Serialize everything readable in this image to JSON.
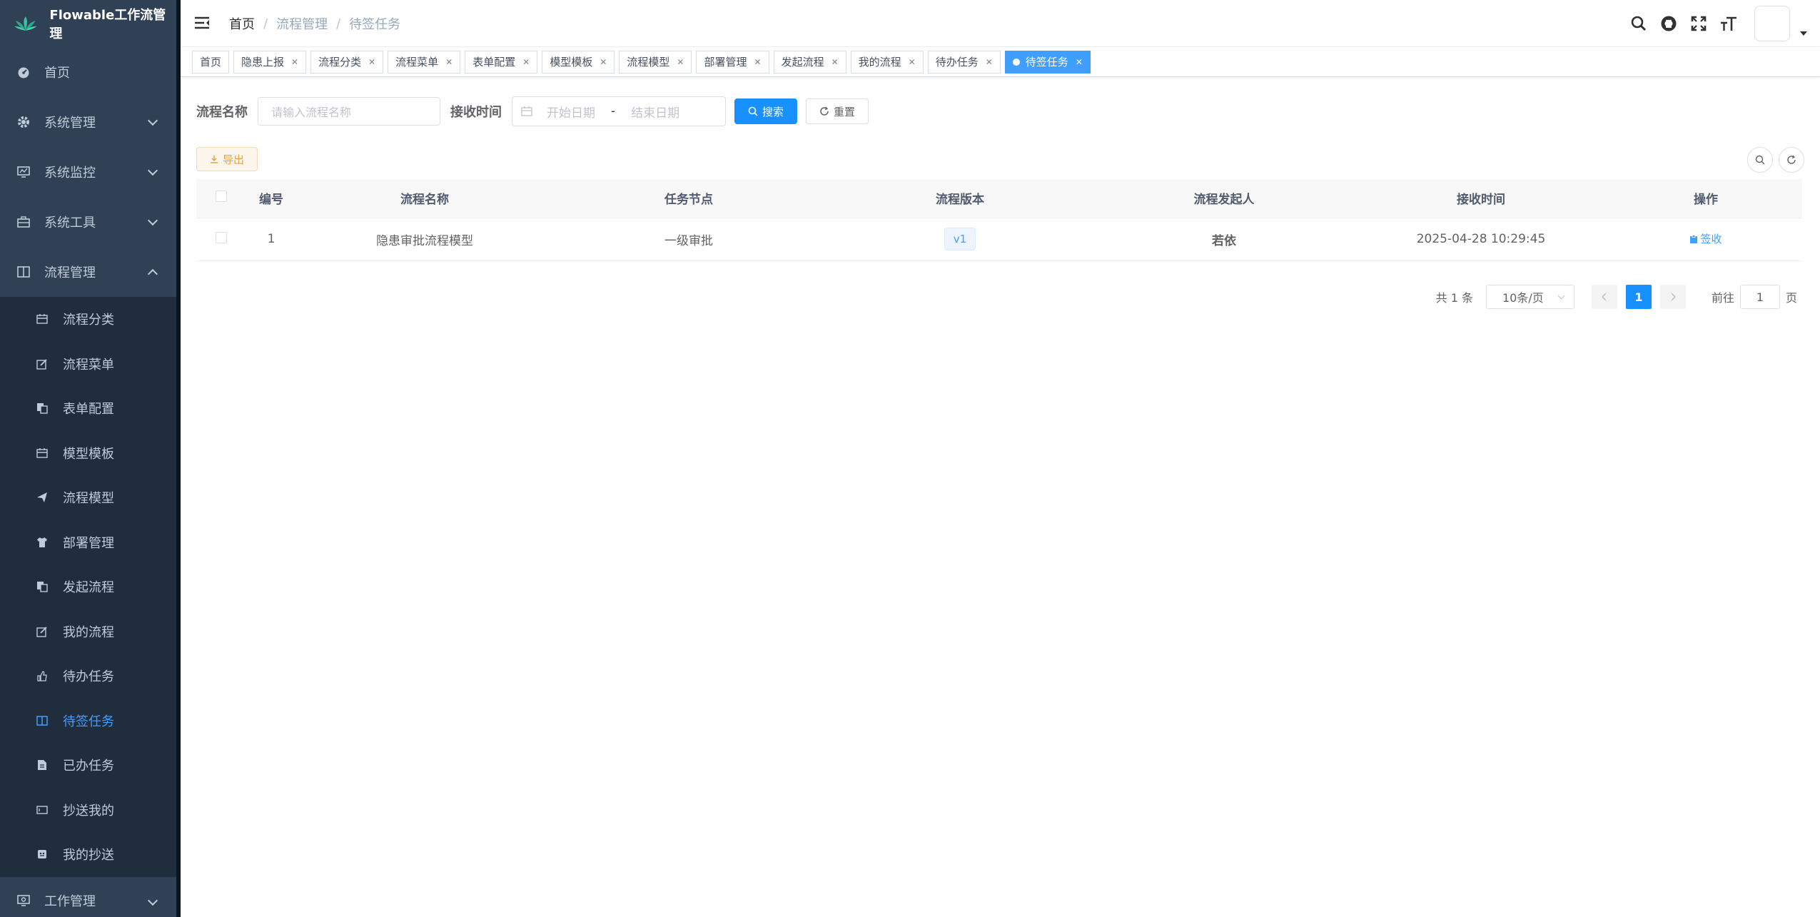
{
  "app": {
    "title": "Flowable工作流管理"
  },
  "sidebar": {
    "items": [
      {
        "label": "首页",
        "icon": "dashboard-icon"
      },
      {
        "label": "系统管理",
        "icon": "system-gear-icon"
      },
      {
        "label": "系统监控",
        "icon": "monitor-icon"
      },
      {
        "label": "系统工具",
        "icon": "toolbox-icon"
      },
      {
        "label": "流程管理",
        "icon": "process-book-icon"
      }
    ],
    "submenu": [
      {
        "label": "流程分类",
        "icon": "calendar-icon"
      },
      {
        "label": "流程菜单",
        "icon": "edit-icon"
      },
      {
        "label": "表单配置",
        "icon": "copy-icon"
      },
      {
        "label": "模型模板",
        "icon": "calendar-icon"
      },
      {
        "label": "流程模型",
        "icon": "send-icon"
      },
      {
        "label": "部署管理",
        "icon": "shirt-icon"
      },
      {
        "label": "发起流程",
        "icon": "copy-icon"
      },
      {
        "label": "我的流程",
        "icon": "edit-icon"
      },
      {
        "label": "待办任务",
        "icon": "hand-icon"
      },
      {
        "label": "待签任务",
        "icon": "book-icon"
      },
      {
        "label": "已办任务",
        "icon": "document-icon"
      },
      {
        "label": "抄送我的",
        "icon": "ticket-icon"
      },
      {
        "label": "我的抄送",
        "icon": "message-icon"
      }
    ],
    "work": {
      "label": "工作管理",
      "icon": "monitor-icon"
    }
  },
  "breadcrumb": [
    "首页",
    "流程管理",
    "待签任务"
  ],
  "tags": [
    {
      "label": "首页",
      "closable": false
    },
    {
      "label": "隐患上报",
      "closable": true
    },
    {
      "label": "流程分类",
      "closable": true
    },
    {
      "label": "流程菜单",
      "closable": true
    },
    {
      "label": "表单配置",
      "closable": true
    },
    {
      "label": "模型模板",
      "closable": true
    },
    {
      "label": "流程模型",
      "closable": true
    },
    {
      "label": "部署管理",
      "closable": true
    },
    {
      "label": "发起流程",
      "closable": true
    },
    {
      "label": "我的流程",
      "closable": true
    },
    {
      "label": "待办任务",
      "closable": true
    },
    {
      "label": "待签任务",
      "closable": true,
      "active": true
    }
  ],
  "search": {
    "name_label": "流程名称",
    "name_placeholder": "请输入流程名称",
    "time_label": "接收时间",
    "start_placeholder": "开始日期",
    "range_separator": "-",
    "end_placeholder": "结束日期",
    "search_button": "搜索",
    "reset_button": "重置"
  },
  "toolbar": {
    "export_button": "导出"
  },
  "table": {
    "columns": [
      "编号",
      "流程名称",
      "任务节点",
      "流程版本",
      "流程发起人",
      "接收时间",
      "操作"
    ],
    "rows": [
      {
        "id": "1",
        "name": "隐患审批流程模型",
        "node": "一级审批",
        "version": "v1",
        "initiator": "若依",
        "time": "2025-04-28 10:29:45",
        "action": "签收"
      }
    ]
  },
  "pagination": {
    "total_text": "共 1 条",
    "page_size": "10条/页",
    "current_page": "1",
    "goto_label": "前往",
    "goto_value": "1",
    "page_suffix": "页"
  },
  "colors": {
    "sidebar_bg": "#304156",
    "submenu_bg": "#1f2d3d",
    "primary": "#1890ff",
    "active_menu": "#409eff"
  }
}
